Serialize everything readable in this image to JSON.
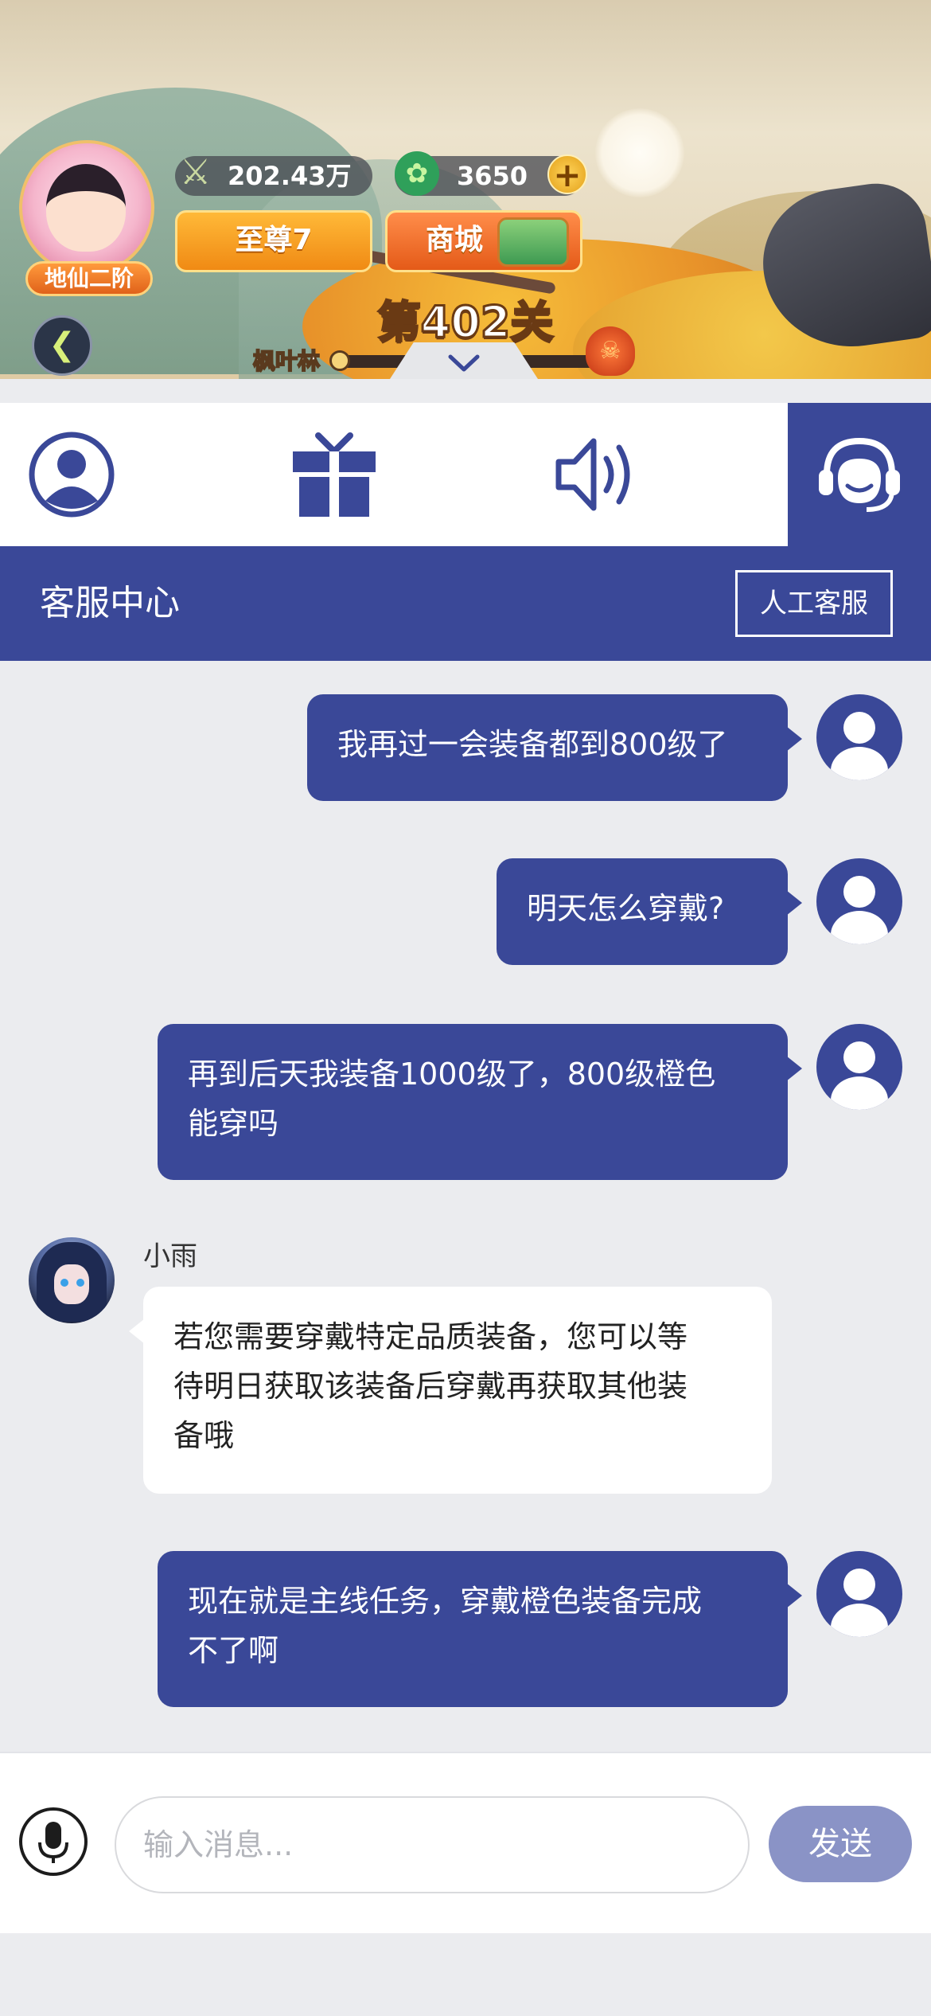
{
  "game": {
    "rank": "地仙二阶",
    "combat_power": "202.43万",
    "currency": "3650",
    "vip_label": "至尊7",
    "shop_label": "商城",
    "level_title": "第402关",
    "stage_name": "枫叶林",
    "stage_progress": 0.02
  },
  "tabs": [
    {
      "icon": "user-circle-icon",
      "active": false
    },
    {
      "icon": "gift-icon",
      "active": false
    },
    {
      "icon": "speaker-icon",
      "active": false
    },
    {
      "icon": "headset-support-icon",
      "active": true
    }
  ],
  "header": {
    "title": "客服中心",
    "human_service_label": "人工客服"
  },
  "messages": [
    {
      "from": "user",
      "text": "我再过一会装备都到800级了"
    },
    {
      "from": "user",
      "text": "明天怎么穿戴?"
    },
    {
      "from": "user",
      "text_lines": [
        "再到后天我装备1000级了，800级橙色",
        "能穿吗"
      ]
    },
    {
      "from": "agent",
      "name": "小雨",
      "text_lines": [
        "若您需要穿戴特定品质装备，您可以等",
        "待明日获取该装备后穿戴再获取其他装",
        "备哦"
      ]
    },
    {
      "from": "user",
      "text_lines": [
        "现在就是主线任务，穿戴橙色装备完成",
        "不了啊"
      ]
    }
  ],
  "input": {
    "placeholder": "输入消息...",
    "value": "",
    "send_label": "发送"
  },
  "colors": {
    "primary": "#3a4898",
    "send_disabled": "#8a93c6",
    "background": "#ebecef"
  }
}
